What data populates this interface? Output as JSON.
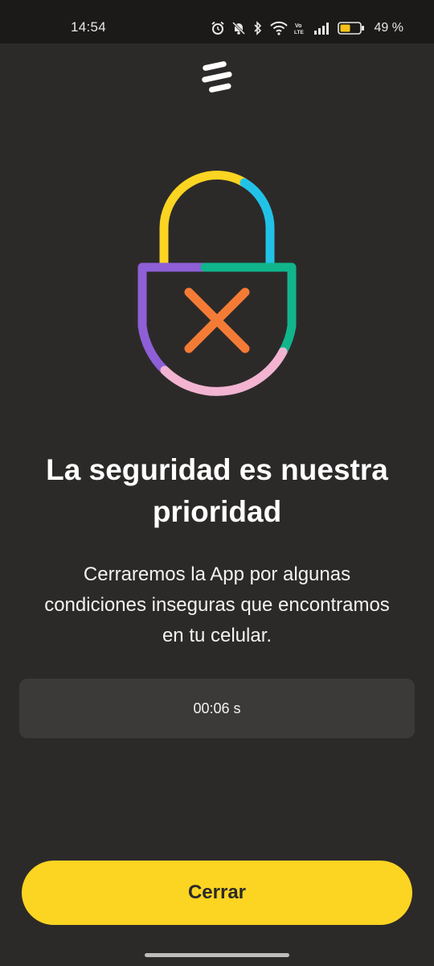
{
  "status_bar": {
    "time": "14:54",
    "battery_percent": "49 %",
    "icons": [
      "alarm-icon",
      "bell-off-icon",
      "bluetooth-icon",
      "wifi-icon",
      "volte-icon",
      "signal-icon",
      "battery-icon"
    ],
    "volte_label": "Vo LTE"
  },
  "logo": {
    "icon": "brand-stripes-icon"
  },
  "illustration": {
    "icon": "padlock-x-icon",
    "colors": {
      "yellow": "#fcd422",
      "cyan": "#22c2e8",
      "purple": "#8e5fd6",
      "green": "#11b58b",
      "pink": "#f2b4d1",
      "orange": "#f47b35"
    }
  },
  "main": {
    "title": "La seguridad es nuestra prioridad",
    "description": "Cerraremos la App por algunas condiciones inseguras que encontramos en tu celular.",
    "timer": "00:06 s"
  },
  "actions": {
    "close_label": "Cerrar"
  },
  "colors": {
    "background": "#2c2a29",
    "status_bar": "#1b1a19",
    "timer_box": "#3b3a39",
    "accent": "#fcd422"
  }
}
